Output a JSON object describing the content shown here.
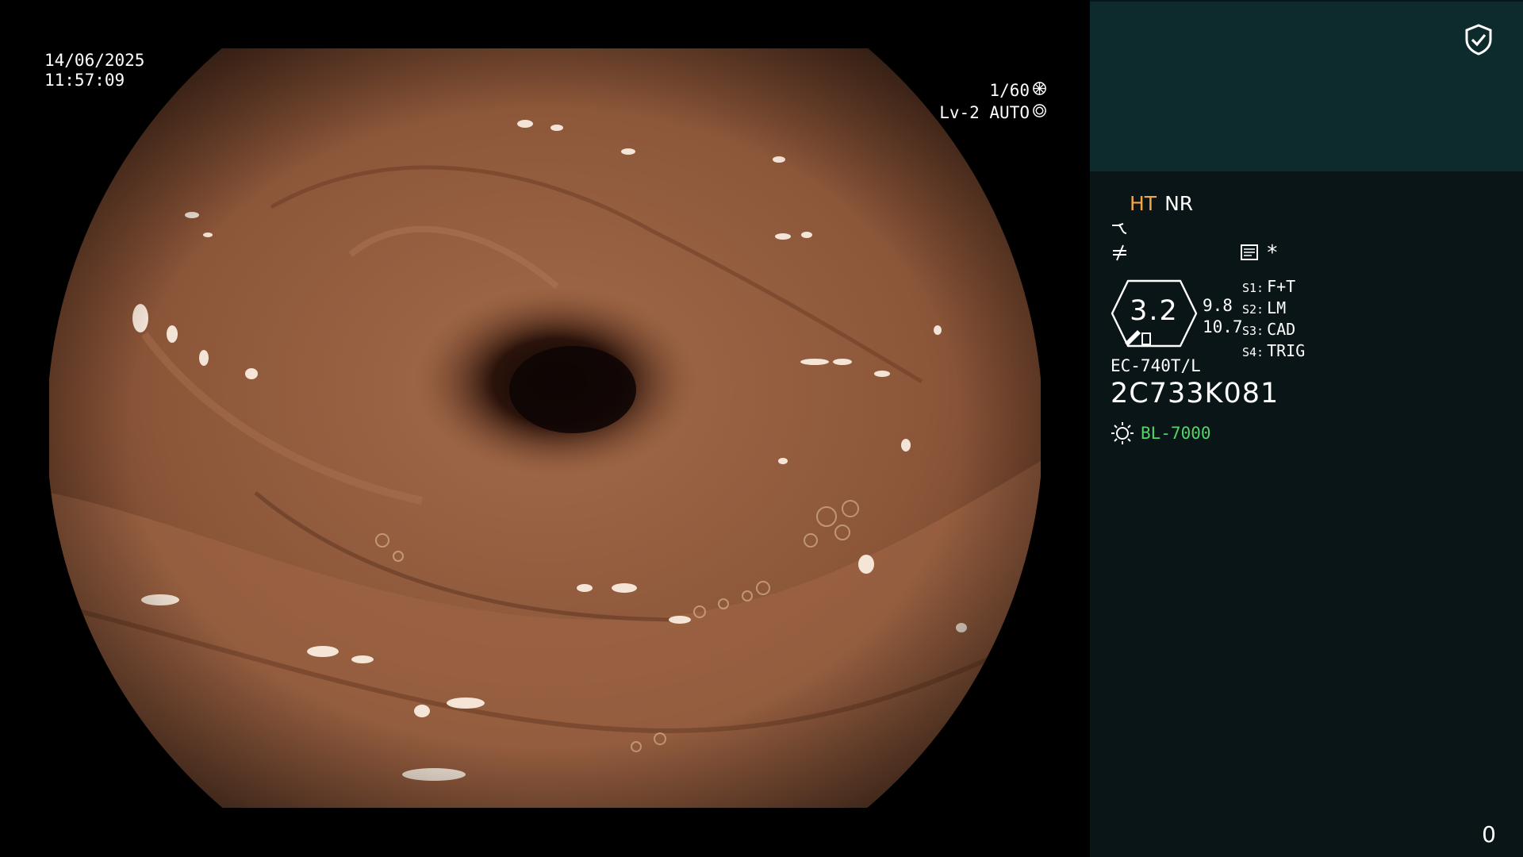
{
  "overlay": {
    "date": "14/06/2025",
    "time": "11:57:09",
    "shutter": "1/60",
    "exposure_mode": "Lv-2 AUTO"
  },
  "panel": {
    "mode_ht": "HT",
    "mode_nr": "NR",
    "zoom": "3.2",
    "zoom_values": [
      "9.8",
      "10.7"
    ],
    "settings": [
      {
        "key": "S1:",
        "value": "F+T"
      },
      {
        "key": "S2:",
        "value": "LM"
      },
      {
        "key": "S3:",
        "value": "CAD"
      },
      {
        "key": "S4:",
        "value": "TRIG"
      }
    ],
    "star": "*",
    "scope_model": "EC-740T/L",
    "serial": "2C733K081",
    "light_source": "BL-7000",
    "counter": "0"
  },
  "icons": [
    "shield-check-icon",
    "aperture-icon",
    "metering-icon",
    "structure-enhance-icon",
    "color-enhance-icon",
    "memo-icon",
    "light-source-icon"
  ],
  "colors": {
    "panel_bg": "#0a1517",
    "panel_top_bg": "#0d2a2c",
    "ht_orange": "#f2a64a",
    "light_green": "#55d36a"
  }
}
